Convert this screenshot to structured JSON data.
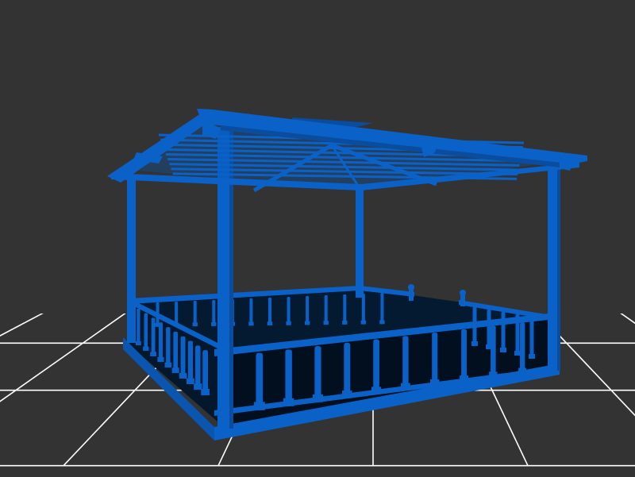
{
  "scene": {
    "background_color": "#333333",
    "grid_color": "#ffffff",
    "model_color": "#0a62c8",
    "model_dark_color": "#0a4c9e",
    "floor_color": "#031a30",
    "subject": "3d-gazebo-model"
  }
}
